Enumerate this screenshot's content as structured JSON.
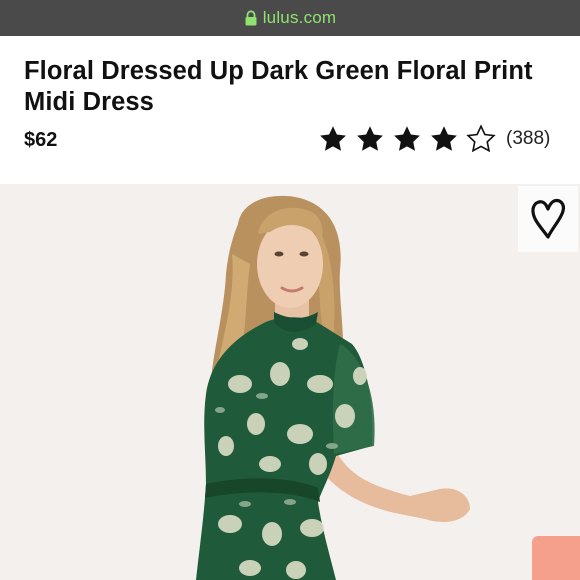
{
  "browser": {
    "url_domain": "lulus.com",
    "lock_icon": "lock-icon"
  },
  "product": {
    "title": "Floral Dressed Up Dark Green Floral Print Midi Dress",
    "price": "$62",
    "rating": {
      "stars_filled": 4,
      "stars_total": 5,
      "review_count": "(388)"
    },
    "favorite_icon": "heart-icon"
  },
  "colors": {
    "url_bar_bg": "#4a4a4a",
    "url_text": "#8fe26f",
    "dress_green": "#1f5a3a",
    "swatch": "#f5a08c"
  }
}
